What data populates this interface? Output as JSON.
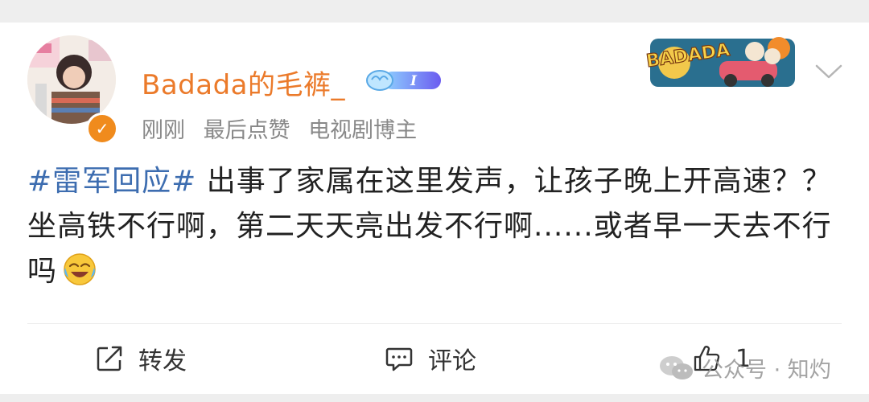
{
  "post": {
    "username": "Badada的毛裤_",
    "level_badge": "I",
    "meta": {
      "time": "刚刚",
      "activity": "最后点赞",
      "role": "电视剧博主"
    },
    "sticker_text": "BADADA",
    "content": {
      "hashtag": "#雷军回应#",
      "text": " 出事了家属在这里发声，让孩子晚上开高速？？ 坐高铁不行啊，第二天天亮出发不行啊......或者早一天去不行吗"
    }
  },
  "actions": {
    "repost_label": "转发",
    "comment_label": "评论",
    "like_count": "1"
  },
  "watermark": "公众号 · 知灼",
  "icons": {
    "verified": "verified-badge-icon",
    "dropdown": "chevron-down-icon",
    "repost": "repost-icon",
    "comment": "comment-icon",
    "like": "thumbs-up-icon",
    "emoji": "laughing-crying-emoji-icon",
    "watermark": "wechat-icon"
  },
  "colors": {
    "username": "#eb7a2a",
    "hashtag": "#3d6db0",
    "verified": "#f08b1d"
  }
}
